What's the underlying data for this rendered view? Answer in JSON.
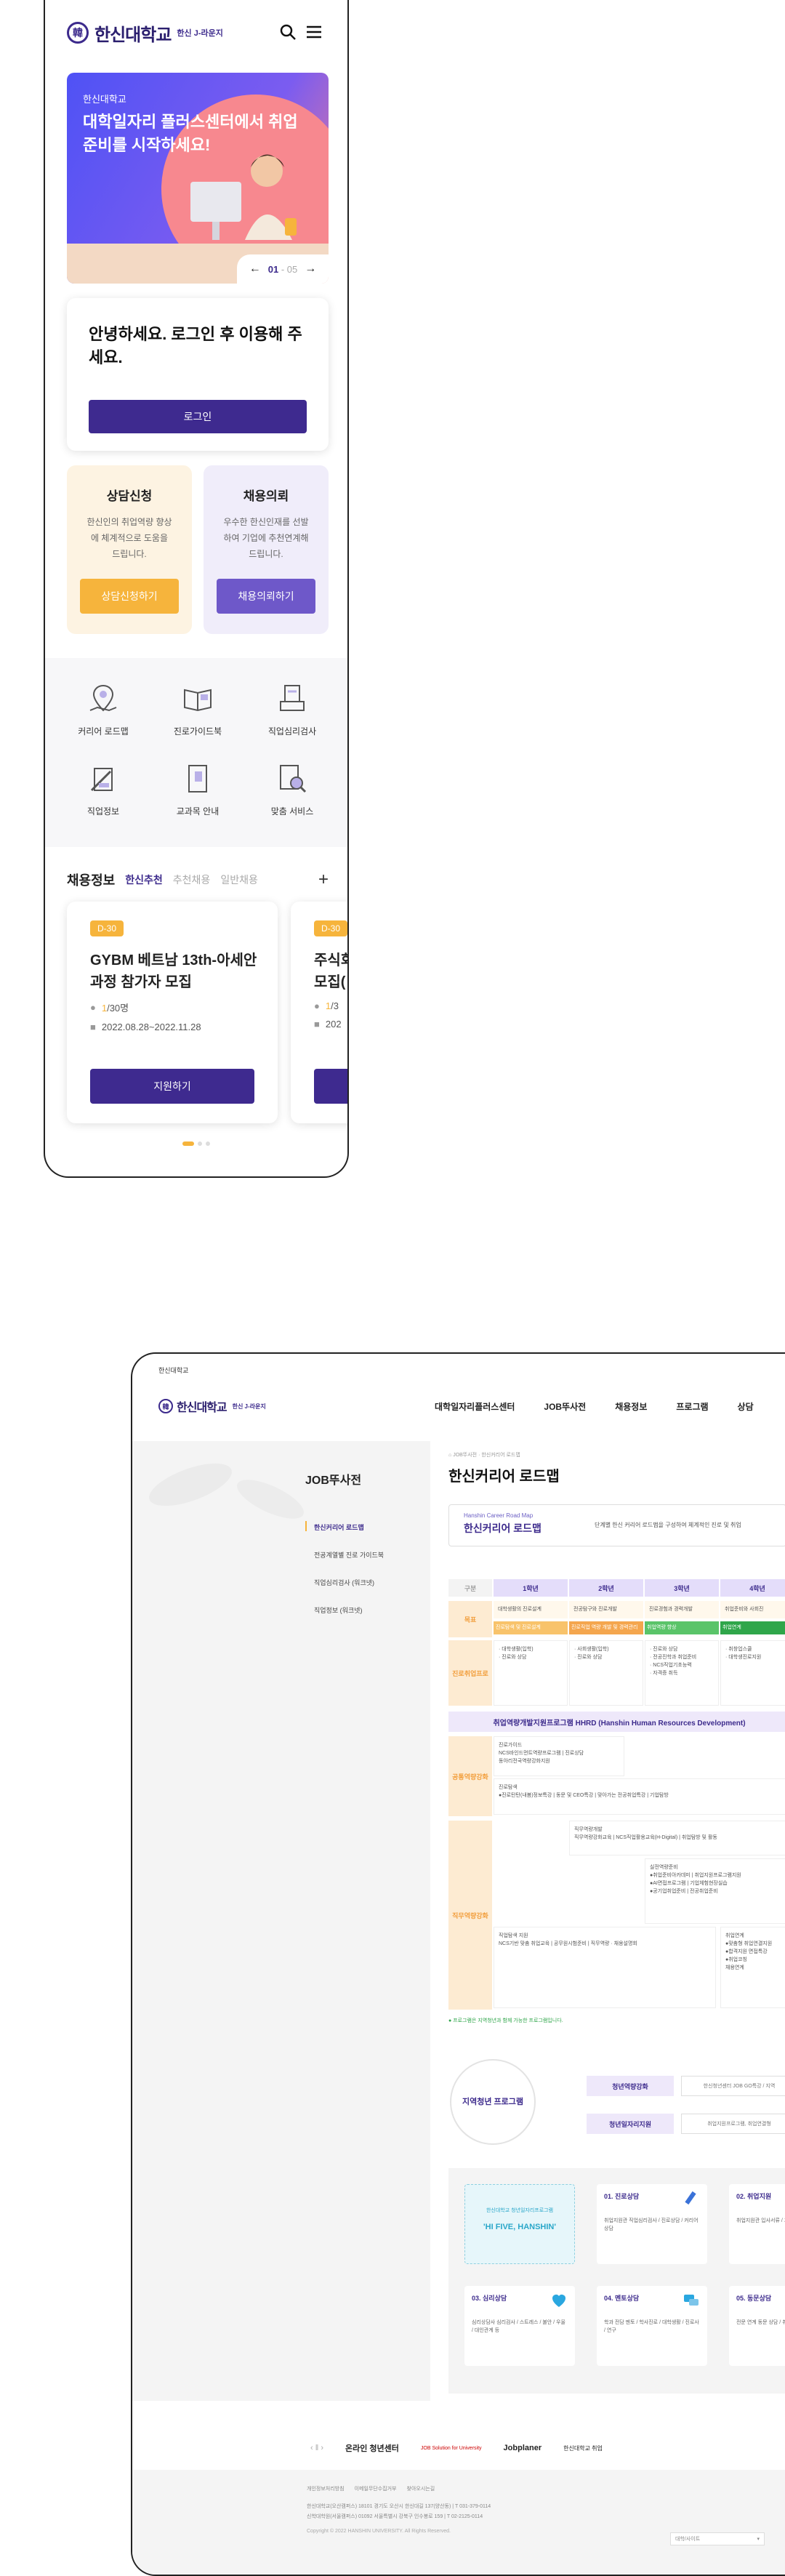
{
  "brand": {
    "name": "한신대학교",
    "sub": "한신 J-라운지",
    "seal": "韓"
  },
  "mobile": {
    "hero": {
      "eyebrow": "한신대학교",
      "title": "대학일자리 플러스센터에서 취업준비를 시작하세요!",
      "pager_current": "01",
      "pager_sep": "-",
      "pager_total": "05"
    },
    "login": {
      "title": "안녕하세요. 로그인 후 이용해 주세요.",
      "button": "로그인"
    },
    "consult": {
      "title": "상담신청",
      "desc": "한신인의 취업역량 향상에 체계적으로 도움을 드립니다.",
      "button": "상담신청하기",
      "color": "#f6b43c",
      "bg": "#fdf3e2"
    },
    "recruit_req": {
      "title": "채용의뢰",
      "desc": "우수한 한신인재를 선발하여 기업에 추천연계해드립니다.",
      "button": "채용의뢰하기",
      "color": "#6e58c9",
      "bg": "#f0edfa"
    },
    "quick": [
      {
        "label": "커리어 로드맵",
        "icon": "map-pin-icon"
      },
      {
        "label": "진로가이드북",
        "icon": "book-icon"
      },
      {
        "label": "직업심리검사",
        "icon": "test-icon"
      },
      {
        "label": "직업정보",
        "icon": "pen-paper-icon"
      },
      {
        "label": "교과목 안내",
        "icon": "notebook-icon"
      },
      {
        "label": "맞춤 서비스",
        "icon": "search-doc-icon"
      }
    ],
    "jobs": {
      "heading": "채용정보",
      "tabs": [
        "한신추천",
        "추천채용",
        "일반채용"
      ],
      "cards": [
        {
          "badge": "D-30",
          "title": "GYBM 베트남 13th-아세안과정 참가자 모집",
          "applied": "1",
          "total": "/30명",
          "period": "2022.08.28~2022.11.28",
          "button": "지원하기"
        },
        {
          "badge": "D-30",
          "title": "주식회 모집(",
          "applied": "1",
          "total": "/3",
          "period": "202",
          "button": "지원하기"
        }
      ]
    }
  },
  "desktop": {
    "top_label": "한신대학교",
    "nav": [
      "대학일자리플러스센터",
      "JOB뚜사전",
      "채용정보",
      "프로그램",
      "상담"
    ],
    "side": {
      "title": "JOB뚜사전",
      "items": [
        "한신커리어 로드맵",
        "전공계열별 진로 가이드북",
        "직업심리검사 (워크넷)",
        "직업정보 (워크넷)"
      ]
    },
    "breadcrumb": "JOB뚜사전 · 한신커리어 로드맵",
    "page_title": "한신커리어 로드맵",
    "roadmap_box": {
      "eyebrow": "Hanshin Career Road Map",
      "title": "한신커리어 로드맵",
      "desc": "단계별 한신 커리어 로드맵을 구성하여 체계적인 진로 및 취업"
    },
    "table": {
      "header_label": "구분",
      "years": [
        "1학년",
        "2학년",
        "3학년",
        "4학년"
      ],
      "row_goal": "목표",
      "goals": [
        "대학생활의 진로설계",
        "전공탐구와 진로개발",
        "진로경험과 경력개발",
        "취업준비와 사회진"
      ],
      "stages": [
        "진로탐색 및 진로설계",
        "진로직업 역량 개발 및 경력관리",
        "취업역량 향상",
        "취업연계"
      ],
      "row_program": "진로취업프로",
      "program_cells": [
        "· 대학생활(입학)\n· 진로와 상담",
        "· 사회생활(입학)\n· 진로와 상담",
        "· 진로와 상담\n· 전공진학과 취업준비\n· NCS직업기초능력\n· 자격증 취득",
        "· 취창업스쿨\n· 대학생진로지원"
      ],
      "hhrd": "취업역량개발지원프로그램 HHRD (Hanshin Human Resources Development)",
      "row_common": "공통역량강화",
      "common_cells": [
        "진로가이드\nNCS바인드먼트역량프로그램 | 진로상담\n 동아리전국역량강화지원",
        "진로탐색\n●진로탄탄(내봄)정보특강 | 동문 및 CEO특강 | 맞아가는 전공취업특강 | 기업탐방"
      ],
      "row_major": "직무역량강화",
      "major_cells": [
        "직무역량개발\n직무역량강화교육 | NCS직업활용교육(H-Digital) | 취업탐방 및 활동",
        "실전역량준비\n●취업준비아카데미 | 취업지원프로그램지원\n●AI면접프로그램 | 기업체험현장실습\n●공기업취업준비 | 전공취업준비",
        "직업탐색 지원\nNCS기반 맞춤 취업교육 | 공무원시험준비 | 직무역량 · 채용설명회",
        "취업연계\n●맞춤형 취업연결지원\n●합격지원 면접특강\n●취업코칭\n채용연계"
      ],
      "note": "● 프로그램은 지역청년과 함께 가능한 프로그램입니다."
    },
    "region": {
      "circle": "지역청년 프로그램",
      "tags": [
        "청년역량강화",
        "청년일자리지원"
      ],
      "descs": [
        "한신청년센터 JOB GO특강 / 지역",
        "취업지원프로그램, 취업연결형"
      ]
    },
    "hifive": {
      "center_title": "한신대학교 청년일자리프로그램",
      "center_slogan": "'HI FIVE, HANSHIN'",
      "cards": [
        {
          "title": "01. 진로상담",
          "desc": "취업지원관 직업심리검사 / 진로상담 / 커리어상담"
        },
        {
          "title": "02. 취업지원",
          "desc": "취업지원관 입사서류 / 기업정보 제공"
        },
        {
          "title": "03. 심리상담",
          "desc": "심리상담사 심리검사 / 스트레스 / 불안 / 우울 / 대인관계 등"
        },
        {
          "title": "04. 멘토상담",
          "desc": "학과 전담 멘토 / 학사진로 / 대학생활 / 진로사 / 연구"
        },
        {
          "title": "05. 동문상담",
          "desc": "전문 연계 동문 상담 / 취직 상담"
        }
      ]
    },
    "footer_logos": [
      "온라인 청년센터",
      "JOB Solution for University",
      "Jobplaner",
      "한신대학교 취업"
    ],
    "footer_links": [
      "개인정보처리방침",
      "이메일무단수집거부",
      "찾아오시는길"
    ],
    "footer_address": [
      "한신대학교(오산캠퍼스) 18101 경기도 오산시 한신대길 137(양산동) | T 031-379-0114",
      "신학대학원(서울캠퍼스) 01092 서울특별시 강북구 인수봉로 159 | T 02-2125-0114"
    ],
    "copyright": "Copyright © 2022 HANSHIN UNIVERSITY. All Rights Reserved.",
    "family_site": "대학/사이트"
  },
  "colors": {
    "primary": "#3e2a8f",
    "accent": "#f6b43c",
    "program": "#fdebd2"
  }
}
